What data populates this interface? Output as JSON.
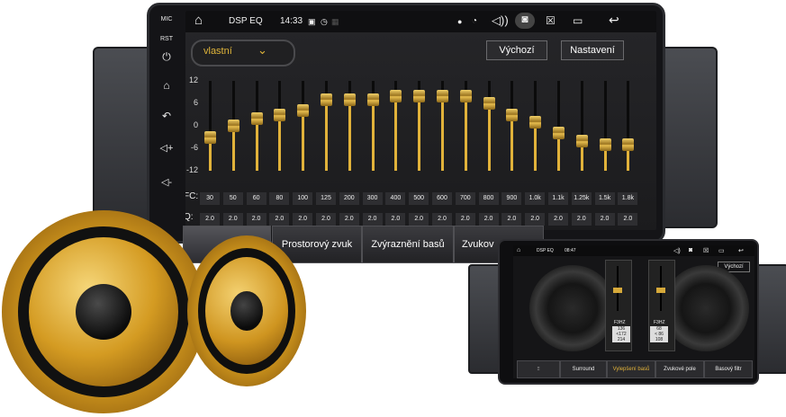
{
  "side_keys": {
    "mic": "MIC",
    "rst": "RST"
  },
  "status": {
    "title": "DSP EQ",
    "time": "14:33"
  },
  "preset": {
    "value": "vlastní"
  },
  "buttons": {
    "default": "Výchozí",
    "settings": "Nastavení"
  },
  "eq": {
    "y_ticks": [
      "12",
      "6",
      "0",
      "-6",
      "-12"
    ],
    "range": [
      -12,
      12
    ],
    "fc_label": "FC:",
    "q_label": "Q:",
    "bands": [
      {
        "fc": "30",
        "q": "2.0",
        "gain": -3
      },
      {
        "fc": "50",
        "q": "2.0",
        "gain": 0
      },
      {
        "fc": "60",
        "q": "2.0",
        "gain": 2
      },
      {
        "fc": "80",
        "q": "2.0",
        "gain": 3
      },
      {
        "fc": "100",
        "q": "2.0",
        "gain": 4
      },
      {
        "fc": "125",
        "q": "2.0",
        "gain": 7
      },
      {
        "fc": "200",
        "q": "2.0",
        "gain": 7
      },
      {
        "fc": "300",
        "q": "2.0",
        "gain": 7
      },
      {
        "fc": "400",
        "q": "2.0",
        "gain": 8
      },
      {
        "fc": "500",
        "q": "2.0",
        "gain": 8
      },
      {
        "fc": "600",
        "q": "2.0",
        "gain": 8
      },
      {
        "fc": "700",
        "q": "2.0",
        "gain": 8
      },
      {
        "fc": "800",
        "q": "2.0",
        "gain": 6
      },
      {
        "fc": "900",
        "q": "2.0",
        "gain": 3
      },
      {
        "fc": "1.0k",
        "q": "2.0",
        "gain": 1
      },
      {
        "fc": "1.1k",
        "q": "2.0",
        "gain": -2
      },
      {
        "fc": "1.25k",
        "q": "2.0",
        "gain": -4
      },
      {
        "fc": "1.5k",
        "q": "2.0",
        "gain": -5
      },
      {
        "fc": "1.8k",
        "q": "2.0",
        "gain": -5
      }
    ]
  },
  "tabs": [
    "Prostorový zvuk",
    "Zvýraznění basů",
    "Zvukov"
  ],
  "phone": {
    "title": "DSP EQ",
    "time": "08:47",
    "button": "Výchozí",
    "left_label": "F3HZ",
    "right_label": "F3HZ",
    "left_values": [
      "136",
      "<172",
      "214"
    ],
    "right_values": [
      "68",
      "< 86",
      "108"
    ],
    "tabs": [
      "Surround",
      "Vylepšení basů",
      "Zvukové pole",
      "Basový filtr"
    ]
  }
}
